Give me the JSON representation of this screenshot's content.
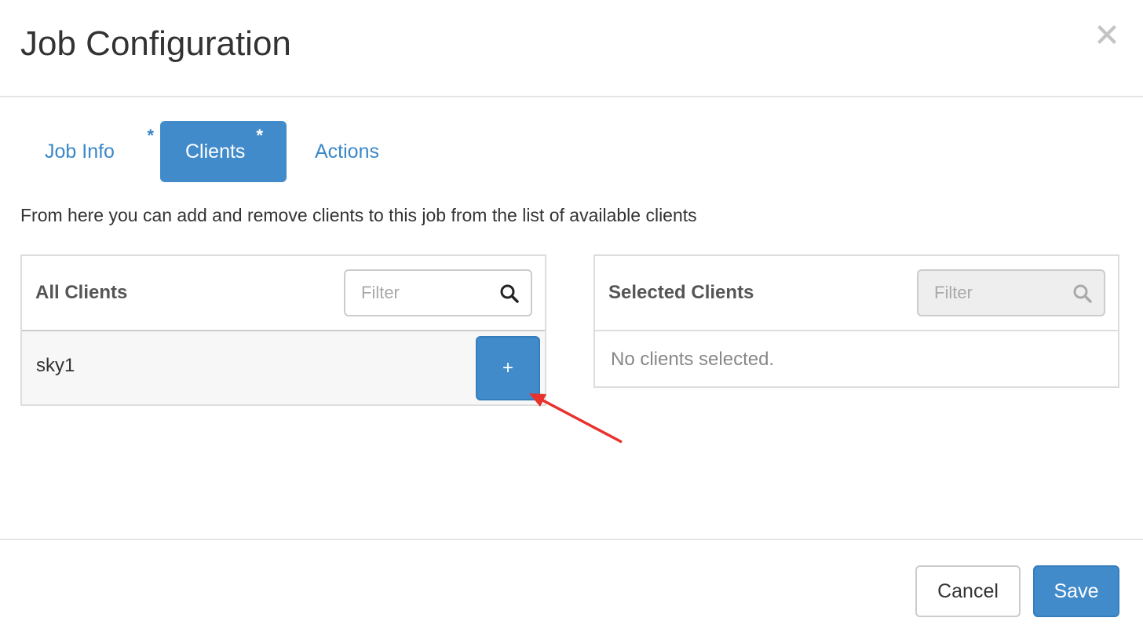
{
  "modal": {
    "title": "Job Configuration",
    "close_icon": "close-icon"
  },
  "tabs": [
    {
      "label": "Job Info",
      "required_mark": "*",
      "active": false
    },
    {
      "label": "Clients",
      "required_mark": "*",
      "active": true
    },
    {
      "label": "Actions",
      "active": false
    }
  ],
  "description": "From here you can add and remove clients to this job from the list of available clients",
  "all_clients": {
    "title": "All Clients",
    "filter_placeholder": "Filter",
    "items": [
      {
        "name": "sky1",
        "add_label": "+"
      }
    ]
  },
  "selected_clients": {
    "title": "Selected Clients",
    "filter_placeholder": "Filter",
    "empty_message": "No clients selected."
  },
  "footer": {
    "cancel_label": "Cancel",
    "save_label": "Save"
  },
  "colors": {
    "primary": "#428bca",
    "link": "#3a87c8",
    "annotation_arrow": "#e8322d"
  }
}
